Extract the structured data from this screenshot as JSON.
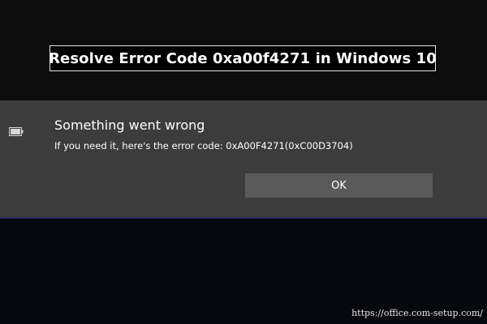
{
  "banner": {
    "title": "Resolve Error Code 0xa00f4271 in Windows 10"
  },
  "dialog": {
    "icon": "battery-icon",
    "title": "Something went wrong",
    "message": "If you need it, here's the error code: 0xA00F4271(0xC00D3704)",
    "ok_label": "OK"
  },
  "watermark": {
    "url": "https://office.com-setup.com/"
  },
  "colors": {
    "background": "#0b0b0b",
    "dialog_background": "#3c3c3c",
    "button_background": "#5a5a5a",
    "accent_line": "#2c2a63",
    "text": "#ffffff"
  }
}
